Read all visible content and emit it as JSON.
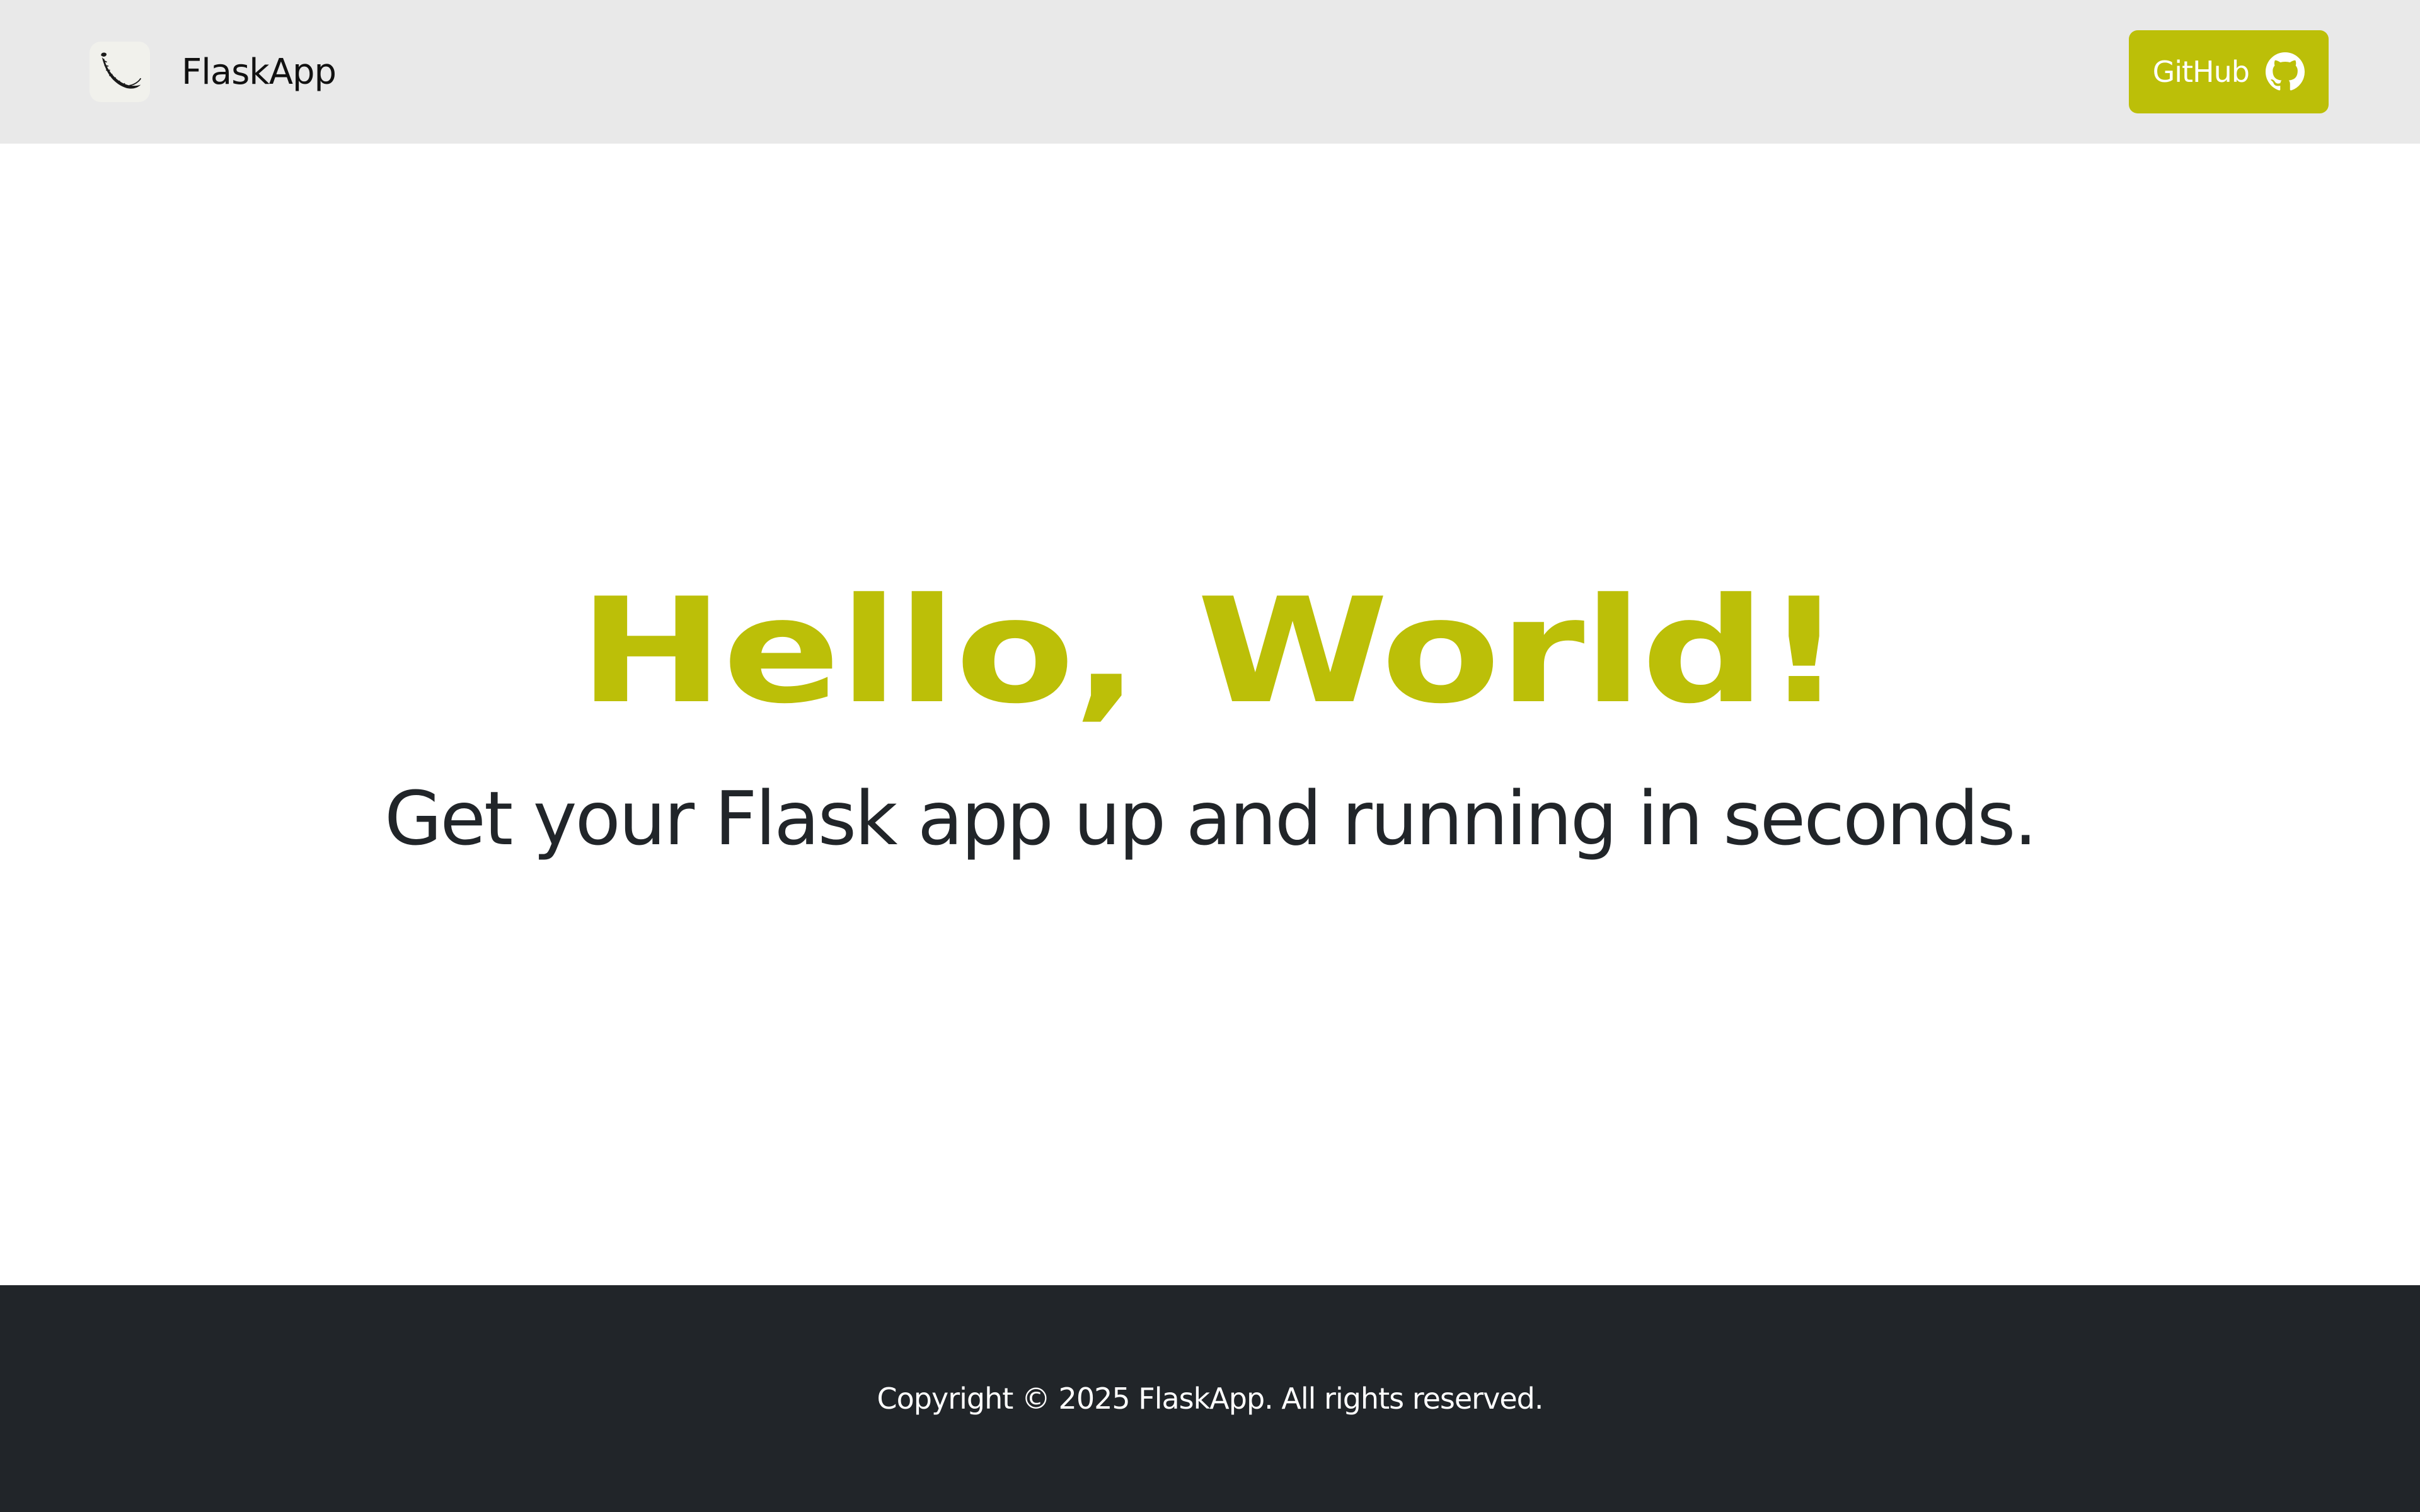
{
  "header": {
    "brand_name": "FlaskApp",
    "logo_icon": "flask-horn-logo",
    "github_button_label": "GitHub",
    "github_icon": "github-icon"
  },
  "hero": {
    "title": "Hello, World!",
    "subtitle": "Get your Flask app up and running in seconds."
  },
  "footer": {
    "copyright": "Copyright © 2025 FlaskApp. All rights reserved."
  },
  "colors": {
    "accent": "#bcbf08",
    "header_bg": "#e9e9e9",
    "footer_bg": "#212529",
    "text_dark": "#212529"
  }
}
